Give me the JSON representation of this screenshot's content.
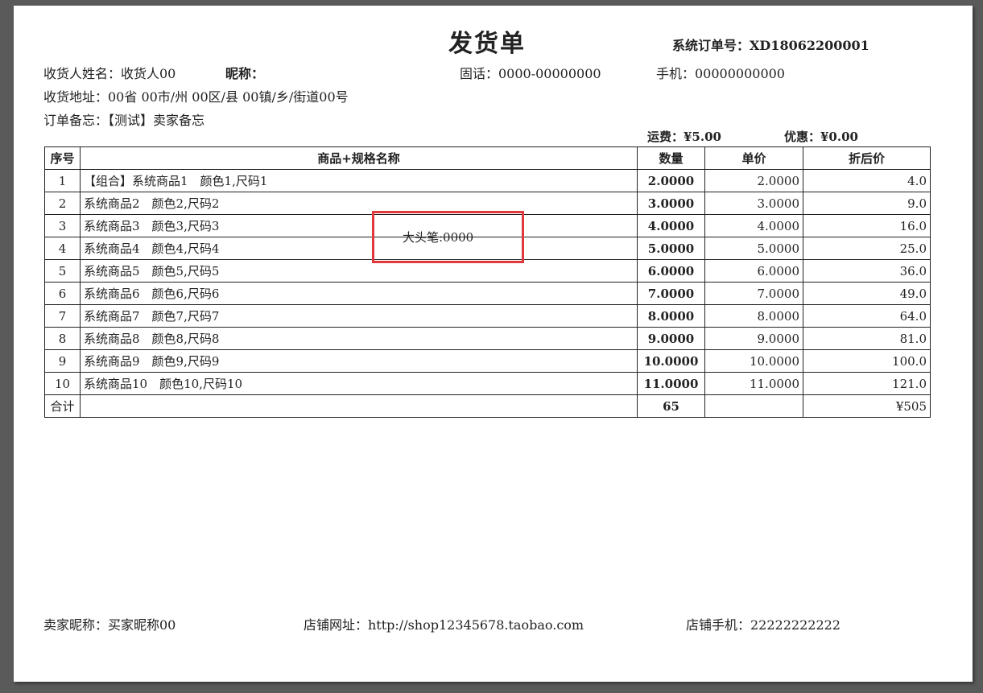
{
  "header": {
    "title": "发货单",
    "order_no_label": "系统订单号：",
    "order_no": "XD18062200001"
  },
  "receiver": {
    "name_line": "收货人姓名：收货人00",
    "nickname_label": "昵称：",
    "landline": "固话：0000-00000000",
    "mobile": "手机：00000000000",
    "address": "收货地址：00省 00市/州 00区/县 00镇/乡/街道00号",
    "memo": "订单备忘：【测试】卖家备忘"
  },
  "fees": {
    "freight": "运费：¥5.00",
    "discount": "优惠：¥0.00"
  },
  "table": {
    "headers": [
      "序号",
      "商品+规格名称",
      "数量",
      "单价",
      "折后价"
    ],
    "rows": [
      {
        "seq": "1",
        "name": "【组合】系统商品1　颜色1,尺码1",
        "qty": "2.0000",
        "price": "2.0000",
        "amount": "4.0"
      },
      {
        "seq": "2",
        "name": "系统商品2　颜色2,尺码2",
        "qty": "3.0000",
        "price": "3.0000",
        "amount": "9.0"
      },
      {
        "seq": "3",
        "name": "系统商品3　颜色3,尺码3",
        "qty": "4.0000",
        "price": "4.0000",
        "amount": "16.0"
      },
      {
        "seq": "4",
        "name": "系统商品4　颜色4,尺码4",
        "qty": "5.0000",
        "price": "5.0000",
        "amount": "25.0"
      },
      {
        "seq": "5",
        "name": "系统商品5　颜色5,尺码5",
        "qty": "6.0000",
        "price": "6.0000",
        "amount": "36.0"
      },
      {
        "seq": "6",
        "name": "系统商品6　颜色6,尺码6",
        "qty": "7.0000",
        "price": "7.0000",
        "amount": "49.0"
      },
      {
        "seq": "7",
        "name": "系统商品7　颜色7,尺码7",
        "qty": "8.0000",
        "price": "8.0000",
        "amount": "64.0"
      },
      {
        "seq": "8",
        "name": "系统商品8　颜色8,尺码8",
        "qty": "9.0000",
        "price": "9.0000",
        "amount": "81.0"
      },
      {
        "seq": "9",
        "name": "系统商品9　颜色9,尺码9",
        "qty": "10.0000",
        "price": "10.0000",
        "amount": "100.0"
      },
      {
        "seq": "10",
        "name": "系统商品10　颜色10,尺码10",
        "qty": "11.0000",
        "price": "11.0000",
        "amount": "121.0"
      }
    ],
    "total": {
      "label": "合计",
      "qty": "65",
      "amount": "¥505"
    }
  },
  "marker": {
    "text": "大头笔:0000",
    "color": "#e0383d"
  },
  "footer": {
    "seller_nick": "卖家昵称：买家昵称00",
    "shop_url": "店铺网址：http://shop12345678.taobao.com",
    "shop_phone": "店铺手机：22222222222"
  }
}
